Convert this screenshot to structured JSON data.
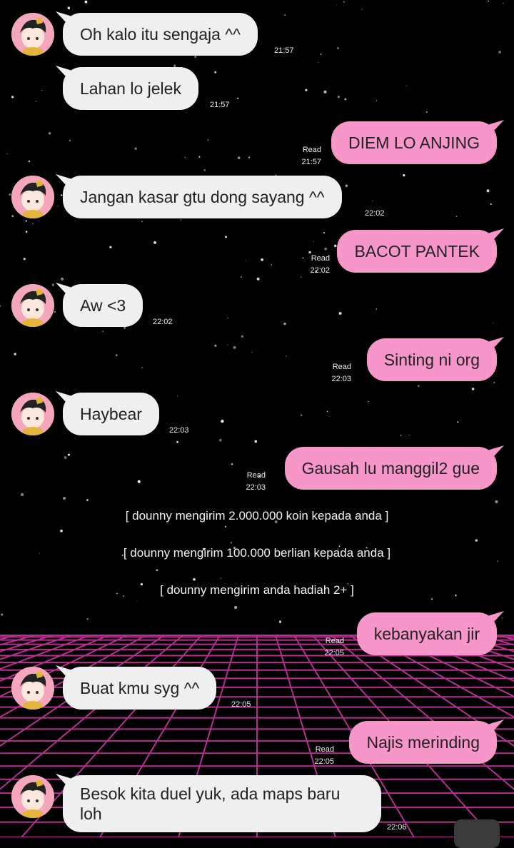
{
  "chat": {
    "messages": [
      {
        "side": "in",
        "text": "Oh kalo itu sengaja ^^",
        "time": "21:57"
      },
      {
        "side": "in",
        "text": "Lahan lo jelek",
        "time": "21:57"
      },
      {
        "side": "out",
        "text": "DIEM LO ANJING",
        "time": "21:57",
        "status": "Read"
      },
      {
        "side": "in",
        "text": "Jangan kasar gtu dong sayang ^^",
        "time": "22:02"
      },
      {
        "side": "out",
        "text": "BACOT PANTEK",
        "time": "22:02",
        "status": "Read"
      },
      {
        "side": "in",
        "text": "Aw <3",
        "time": "22:02"
      },
      {
        "side": "out",
        "text": "Sinting ni org",
        "time": "22:03",
        "status": "Read"
      },
      {
        "side": "in",
        "text": "Haybear",
        "time": "22:03"
      },
      {
        "side": "out",
        "text": "Gausah lu manggil2 gue",
        "time": "22:03",
        "status": "Read"
      },
      {
        "side": "out",
        "text": "kebanyakan jir",
        "time": "22:05",
        "status": "Read"
      },
      {
        "side": "in",
        "text": "Buat kmu syg ^^",
        "time": "22:05"
      },
      {
        "side": "out",
        "text": "Najis merinding",
        "time": "22:05",
        "status": "Read"
      },
      {
        "side": "in",
        "text": "Besok kita duel yuk, ada maps baru loh",
        "time": "22:06"
      }
    ],
    "system_notices": [
      "[ dounny mengirim 2.000.000 koin kepada anda ]",
      "[ dounny mengirim 100.000 berlian kepada anda ]",
      "[ dounny mengirim anda hadiah 2+ ]"
    ]
  },
  "theme": {
    "incoming_bubble": "#efefef",
    "outgoing_bubble": "#f796c8",
    "background": "#000000",
    "grid_color": "#d63aa8"
  },
  "icons": {
    "avatar": "chibi-character-avatar-icon"
  }
}
